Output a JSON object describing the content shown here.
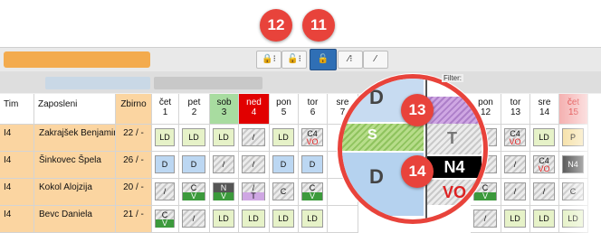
{
  "callouts": {
    "a": "12",
    "b": "11",
    "c": "13",
    "d": "14"
  },
  "toolbar": {
    "btn1_icon": "lock-icon",
    "btn1": "🔒⁝",
    "btn2_icon": "unlock-icon",
    "btn2": "🔓⁝",
    "btn3_icon": "unlock-icon",
    "btn3": "🔓",
    "btn4_icon": "magic-wand-icon",
    "btn4": "⁄⁝",
    "btn5_icon": "wand-icon",
    "btn5": "⁄"
  },
  "filter_label": "Filter:",
  "headers": {
    "tim": "Tim",
    "zaposleni": "Zaposleni",
    "zbirno": "Zbirno",
    "days": [
      {
        "d": "čet",
        "n": "1",
        "bg": "#ffffff",
        "fg": "#111"
      },
      {
        "d": "pet",
        "n": "2",
        "bg": "#ffffff",
        "fg": "#111"
      },
      {
        "d": "sob",
        "n": "3",
        "bg": "#a8dca0",
        "fg": "#111"
      },
      {
        "d": "ned",
        "n": "4",
        "bg": "#e10000",
        "fg": "#ffffff"
      },
      {
        "d": "pon",
        "n": "5",
        "bg": "#ffffff",
        "fg": "#111"
      },
      {
        "d": "tor",
        "n": "6",
        "bg": "#ffffff",
        "fg": "#111"
      },
      {
        "d": "sre",
        "n": "7",
        "bg": "#ffffff",
        "fg": "#111"
      },
      {
        "d": "pon",
        "n": "12",
        "bg": "#ffffff",
        "fg": "#111"
      },
      {
        "d": "tor",
        "n": "13",
        "bg": "#ffffff",
        "fg": "#111"
      },
      {
        "d": "sre",
        "n": "14",
        "bg": "#ffffff",
        "fg": "#111"
      },
      {
        "d": "čet",
        "n": "15",
        "bg": "#f5b3b3",
        "fg": "#d33"
      }
    ]
  },
  "rows": [
    {
      "tim": "I4",
      "name": "Zakrajšek Benjamin",
      "zbir": "22 / -",
      "cells": [
        "LD",
        "LD",
        "LD",
        "/",
        "LD",
        "C4|VO",
        "",
        "/",
        "C4|VO",
        "LD",
        "P"
      ]
    },
    {
      "tim": "I4",
      "name": "Šinkovec Špela",
      "zbir": "26 / -",
      "cells": [
        "D",
        "D",
        "/",
        "/",
        "D",
        "D",
        "",
        "/",
        "/",
        "C4|VO",
        "N4"
      ]
    },
    {
      "tim": "I4",
      "name": "Kokol Alojzija",
      "zbir": "20 / -",
      "cells": [
        "/",
        "C|V",
        "N|V",
        "/|T",
        "C",
        "C|V",
        "",
        "C|V",
        "/",
        "/",
        "C"
      ]
    },
    {
      "tim": "I4",
      "name": "Bevc Daniela",
      "zbir": "21 / -",
      "cells": [
        "C|V",
        "/",
        "LD",
        "LD",
        "LD",
        "LD",
        "",
        "/",
        "LD",
        "LD",
        "LD"
      ]
    }
  ],
  "zoom": {
    "top_label": "D",
    "mid_label": "S",
    "right_top": "/",
    "right_t": "T",
    "big_d": "D",
    "n4": "N4",
    "vo": "VO"
  }
}
